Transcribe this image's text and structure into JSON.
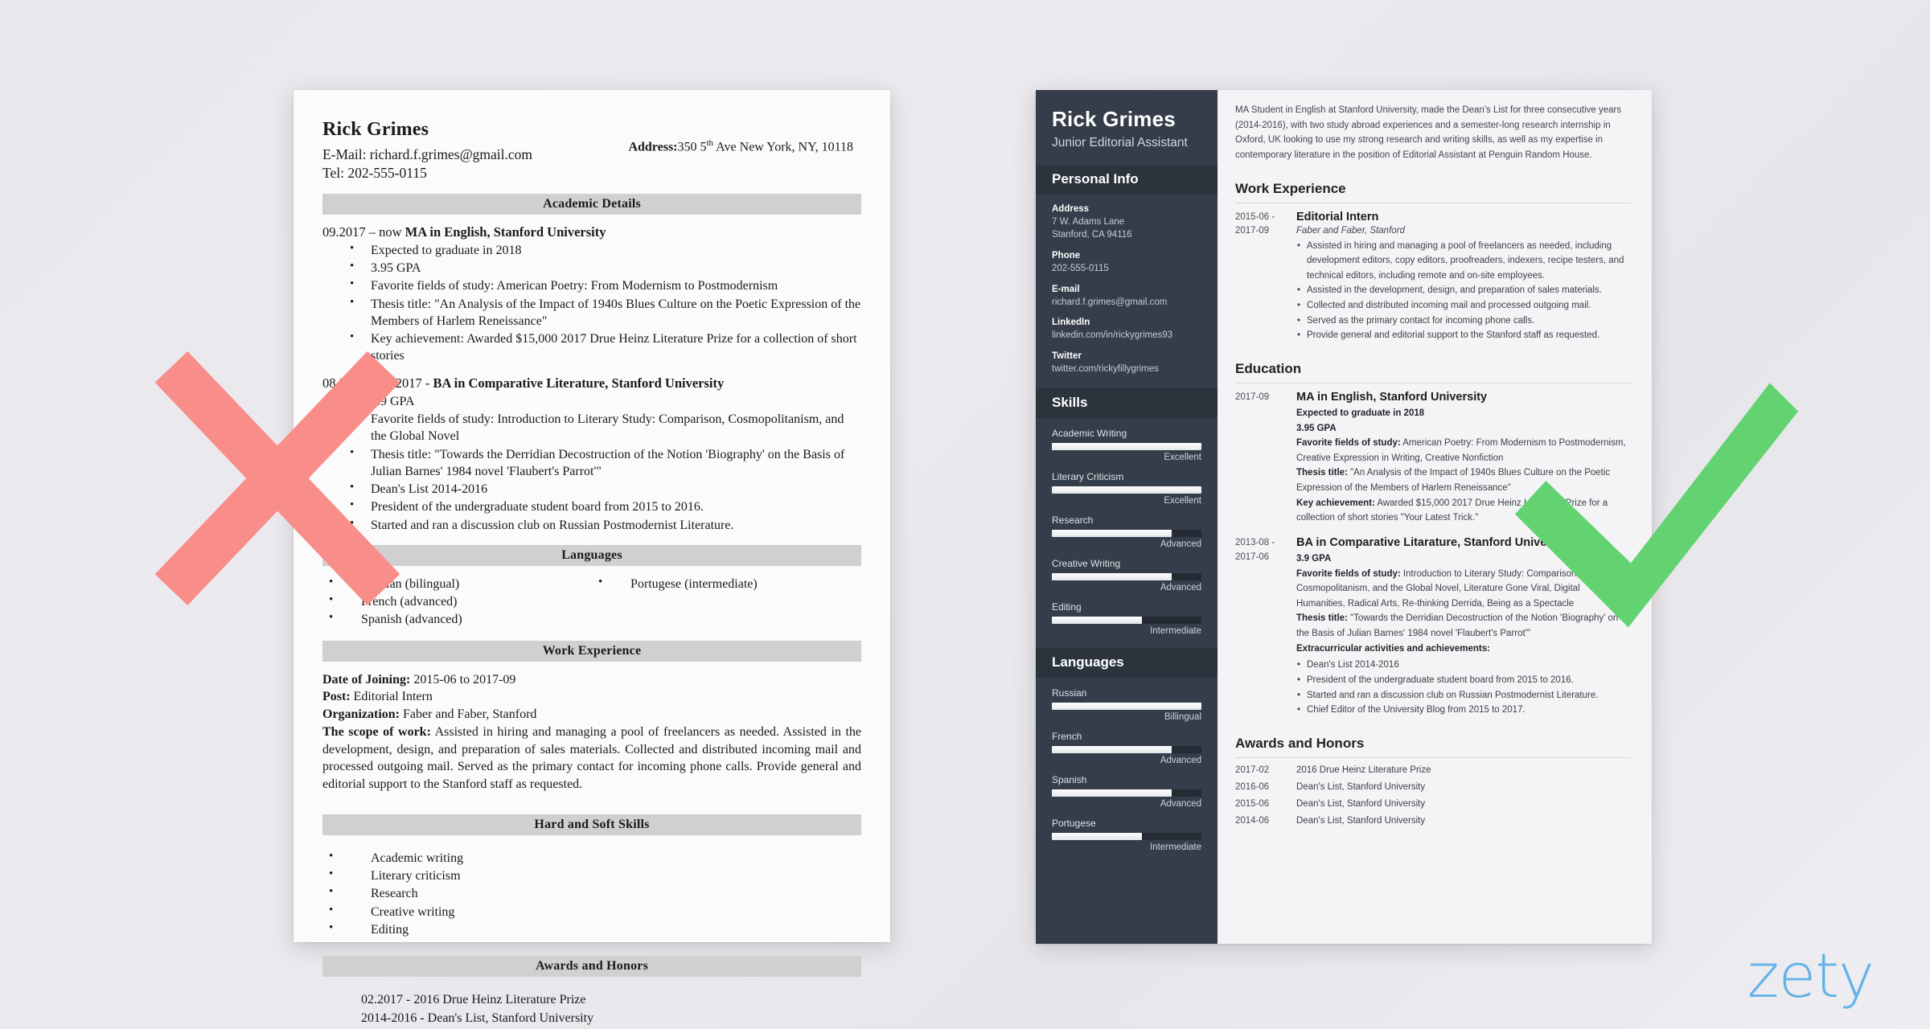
{
  "page": {
    "background_color": "#eceaee",
    "brand_logo_text": "zety",
    "brand_color": "#63b3e8",
    "cross_mark_color": "#f98d89",
    "check_mark_color": "#62d370"
  },
  "bad_resume": {
    "name": "Rick Grimes",
    "email_line": "E-Mail: richard.f.grimes@gmail.com",
    "tel_line": "Tel: 202-555-0115",
    "address_label": "Address:",
    "address_value_a": "350 5",
    "address_value_sup": "th",
    "address_value_b": " Ave New York, NY, 10118",
    "sections": {
      "academic_details": "Academic Details",
      "languages": "Languages",
      "work_experience": "Work Experience",
      "hard_and_soft_skills": "Hard and Soft Skills",
      "awards_and_honors": "Awards and Honors"
    },
    "education": [
      {
        "dates": "09.2017 – now ",
        "degree": "MA in English, Stanford University",
        "bullets": [
          "Expected to graduate in 2018",
          "3.95 GPA",
          "Favorite fields of study: American Poetry: From Modernism to Postmodernism",
          "Thesis title: \"An Analysis of the Impact of 1940s Blues Culture on the Poetic Expression of the Members of Harlem Reneissance\"",
          "Key achievement: Awarded $15,000 2017 Drue Heinz Literature Prize for a collection of short stories"
        ]
      },
      {
        "dates": "08.2013 – 06.2017 - ",
        "degree": "BA in Comparative Literature, Stanford University",
        "bullets": [
          "3.9 GPA",
          "Favorite fields of study: Introduction to Literary Study: Comparison, Cosmopolitanism, and the Global Novel",
          "Thesis title: \"Towards the Derridian Decostruction of the Notion 'Biography' on the Basis of Julian Barnes' 1984 novel 'Flaubert's Parrot'\"",
          "Dean's List 2014-2016",
          "President of the undergraduate student board from 2015 to 2016.",
          "Started and ran a discussion club on Russian Postmodernist Literature."
        ]
      }
    ],
    "languages_col1": [
      "Russian  (bilingual)",
      "French (advanced)",
      "Spanish (advanced)"
    ],
    "languages_col2": [
      "Portugese (intermediate)"
    ],
    "work": {
      "date_label": "Date of Joining:",
      "date_value": " 2015-06 to 2017-09",
      "post_label": "Post:",
      "post_value": " Editorial Intern",
      "org_label": "Organization:",
      "org_value": " Faber and Faber, Stanford",
      "scope_label": "The scope of work:",
      "scope_value": " Assisted in hiring and managing a pool of freelancers as needed. Assisted in the development, design, and preparation of sales materials. Collected and distributed incoming mail and processed outgoing mail. Served as the primary contact for incoming phone calls. Provide general and editorial support to the Stanford staff as requested."
    },
    "skills": [
      "Academic writing",
      "Literary criticism",
      "Research",
      "Creative writing",
      "Editing"
    ],
    "awards": [
      "02.2017 - 2016 Drue Heinz Literature Prize",
      "2014-2016 - Dean's List, Stanford University"
    ]
  },
  "good_resume": {
    "sidebar": {
      "name": "Rick Grimes",
      "job_title": "Junior Editorial Assistant",
      "personal_info_heading": "Personal Info",
      "personal_info": [
        {
          "label": "Address",
          "value": "7 W. Adams Lane\nStanford, CA 94116"
        },
        {
          "label": "Phone",
          "value": "202-555-0115"
        },
        {
          "label": "E-mail",
          "value": "richard.f.grimes@gmail.com"
        },
        {
          "label": "LinkedIn",
          "value": "linkedin.com/in/rickygrimes93"
        },
        {
          "label": "Twitter",
          "value": "twitter.com/rickyfillygrimes"
        }
      ],
      "skills_heading": "Skills",
      "skills": [
        {
          "name": "Academic Writing",
          "level": "Excellent",
          "percent": 100
        },
        {
          "name": "Literary Criticism",
          "level": "Excellent",
          "percent": 100
        },
        {
          "name": "Research",
          "level": "Advanced",
          "percent": 80
        },
        {
          "name": "Creative Writing",
          "level": "Advanced",
          "percent": 80
        },
        {
          "name": "Editing",
          "level": "Intermediate",
          "percent": 60
        }
      ],
      "languages_heading": "Languages",
      "languages": [
        {
          "name": "Russian",
          "level": "Billingual",
          "percent": 100
        },
        {
          "name": "French",
          "level": "Advanced",
          "percent": 80
        },
        {
          "name": "Spanish",
          "level": "Advanced",
          "percent": 80
        },
        {
          "name": "Portugese",
          "level": "Intermediate",
          "percent": 60
        }
      ]
    },
    "main": {
      "summary": "MA Student in English at Stanford University, made the Dean's List for three consecutive years (2014-2016), with two study abroad experiences and a semester-long research internship in Oxford, UK looking to use my strong research and writing skills, as well as my expertise in contemporary literature in the position of Editorial Assistant at Penguin Random House.",
      "work_experience_heading": "Work Experience",
      "work_experience": [
        {
          "date": "2015-06 -\n2017-09",
          "title": "Editorial Intern",
          "org": "Faber and Faber, Stanford",
          "bullets": [
            "Assisted in hiring and managing a pool of freelancers as needed, including development editors, copy editors, proofreaders, indexers, recipe testers, and technical editors, including remote and on-site employees.",
            "Assisted in the development, design, and preparation of sales materials.",
            "Collected and distributed incoming mail and processed outgoing mail.",
            "Served as the primary contact for incoming phone calls.",
            "Provide general and editorial support to the Stanford staff as requested."
          ]
        }
      ],
      "education_heading": "Education",
      "education": [
        {
          "date": "2017-09",
          "title": "MA in English, Stanford University",
          "lines": [
            {
              "bold": "Expected to graduate in 2018",
              "rest": ""
            },
            {
              "bold": "3.95 GPA",
              "rest": ""
            },
            {
              "bold": "Favorite fields of study:",
              "rest": " American Poetry: From Modernism to Postmodernism, Creative Expression in Writing, Creative Nonfiction"
            },
            {
              "bold": "Thesis title:",
              "rest": " \"An Analysis of the Impact of 1940s Blues Culture on the Poetic Expression of the Members of Harlem Reneissance\""
            },
            {
              "bold": "Key achievement:",
              "rest": " Awarded $15,000 2017 Drue Heinz Literature Prize for a collection of short stories \"Your Latest Trick.\""
            }
          ],
          "bullets": []
        },
        {
          "date": "2013-08 -\n2017-06",
          "title": "BA in Comparative Litarature, Stanford University",
          "lines": [
            {
              "bold": "3.9 GPA",
              "rest": ""
            },
            {
              "bold": "Favorite fields of study:",
              "rest": " Introduction to Literary Study: Comparison, Cosmopolitanism, and the Global Novel, Literature Gone Viral, Digital Humanities, Radical Arts, Re-thinking Derrida, Being as a Spectacle"
            },
            {
              "bold": "Thesis title:",
              "rest": " \"Towards the Derridian Decostruction of the Notion 'Biography' on the Basis of Julian Barnes' 1984 novel 'Flaubert's Parrot'\""
            },
            {
              "bold": "Extracurricular activities and achievements:",
              "rest": ""
            }
          ],
          "bullets": [
            "Dean's List 2014-2016",
            "President of the undergraduate student board from 2015 to 2016.",
            "Started and ran a discussion club on Russian Postmodernist Literature.",
            "Chief Editor of the University Blog from 2015 to 2017."
          ]
        }
      ],
      "awards_heading": "Awards and Honors",
      "awards": [
        {
          "date": "2017-02",
          "text": "2016 Drue Heinz Literature Prize"
        },
        {
          "date": "2016-06",
          "text": "Dean's List, Stanford University"
        },
        {
          "date": "2015-06",
          "text": "Dean's List, Stanford University"
        },
        {
          "date": "2014-06",
          "text": "Dean's List, Stanford University"
        }
      ]
    }
  }
}
